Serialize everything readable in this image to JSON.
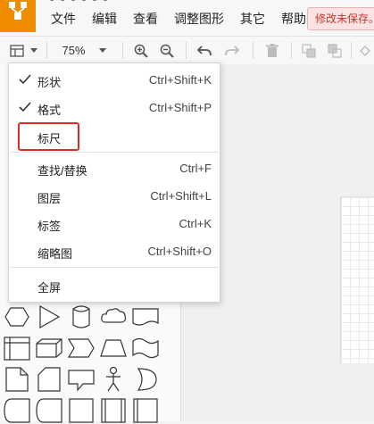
{
  "app": {
    "title_partial": "- - - - - -",
    "menu": [
      "文件",
      "编辑",
      "查看",
      "调整图形",
      "其它",
      "帮助"
    ],
    "unsaved_badge": "修改未保存。"
  },
  "toolbar": {
    "zoom": "75%",
    "icons": [
      "panel-toggle-icon",
      "zoom-dropdown-icon",
      "zoom-in-icon",
      "zoom-out-icon",
      "undo-icon",
      "redo-icon",
      "delete-icon",
      "to-front-icon",
      "to-back-icon"
    ]
  },
  "view_menu": {
    "items": [
      {
        "label": "形状",
        "shortcut": "Ctrl+Shift+K",
        "checked": true
      },
      {
        "label": "格式",
        "shortcut": "Ctrl+Shift+P",
        "checked": true
      },
      {
        "label": "标尺",
        "shortcut": "",
        "checked": false,
        "highlighted": true
      },
      {
        "label": "查找/替换",
        "shortcut": "Ctrl+F",
        "checked": false
      },
      {
        "label": "图层",
        "shortcut": "Ctrl+Shift+L",
        "checked": false
      },
      {
        "label": "标签",
        "shortcut": "Ctrl+K",
        "checked": false
      },
      {
        "label": "缩略图",
        "shortcut": "Ctrl+Shift+O",
        "checked": false
      },
      {
        "label": "全屏",
        "shortcut": "",
        "checked": false
      }
    ]
  },
  "colors": {
    "logo": "#f08c00",
    "highlight": "#e02b2b",
    "badge_text": "#c0392b",
    "badge_bg": "#fbe3e3"
  }
}
